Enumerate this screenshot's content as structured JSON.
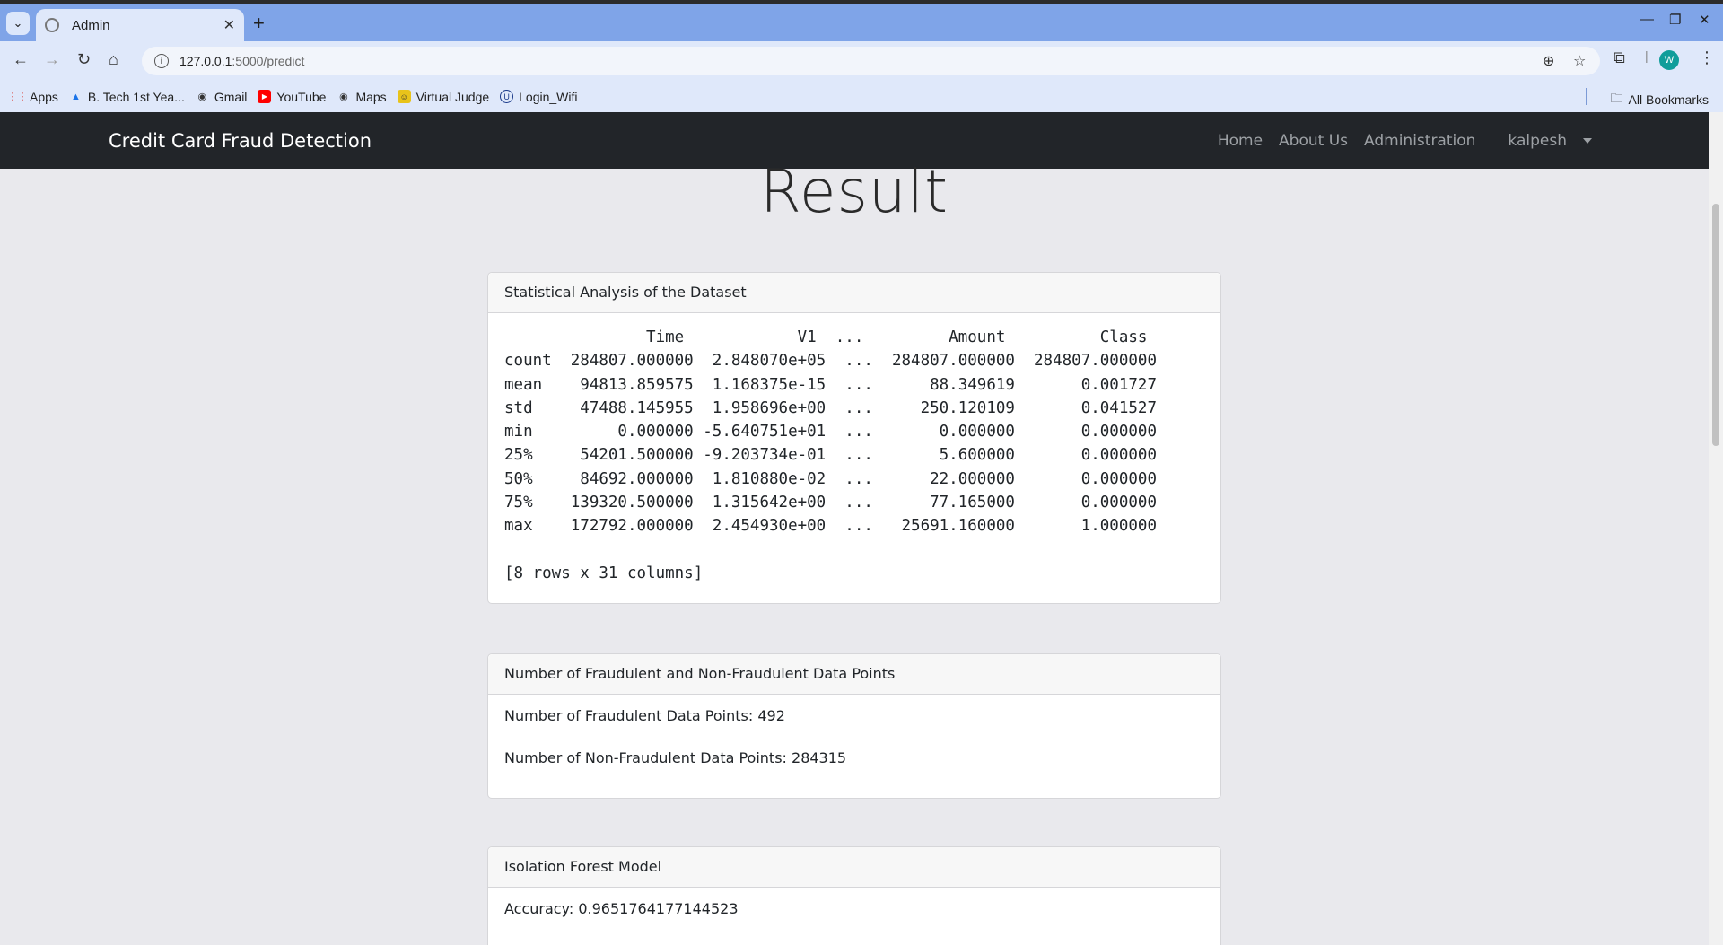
{
  "browser": {
    "tab_title": "Admin",
    "url_host": "127.0.0.1",
    "url_path": ":5000/predict",
    "avatar_letter": "W",
    "bookmarks": [
      {
        "label": "Apps",
        "icon": "apps-grid-icon"
      },
      {
        "label": "B. Tech 1st Yea...",
        "icon": "google-drive-icon"
      },
      {
        "label": "Gmail",
        "icon": "globe-icon"
      },
      {
        "label": "YouTube",
        "icon": "youtube-icon"
      },
      {
        "label": "Maps",
        "icon": "globe-icon"
      },
      {
        "label": "Virtual Judge",
        "icon": "virtual-judge-icon"
      },
      {
        "label": "Login_Wifi",
        "icon": "login-wifi-icon"
      }
    ],
    "all_bookmarks": "All Bookmarks"
  },
  "navbar": {
    "brand": "Credit Card Fraud Detection",
    "links": [
      "Home",
      "About Us",
      "Administration",
      "kalpesh"
    ]
  },
  "page": {
    "title": "Result"
  },
  "cards": {
    "stats": {
      "header": "Statistical Analysis of the Dataset",
      "table": "               Time            V1  ...         Amount          Class\ncount  284807.000000  2.848070e+05  ...  284807.000000  284807.000000\nmean    94813.859575  1.168375e-15  ...      88.349619       0.001727\nstd     47488.145955  1.958696e+00  ...     250.120109       0.041527\nmin         0.000000 -5.640751e+01  ...       0.000000       0.000000\n25%     54201.500000 -9.203734e-01  ...       5.600000       0.000000\n50%     84692.000000  1.810880e-02  ...      22.000000       0.000000\n75%    139320.500000  1.315642e+00  ...      77.165000       0.000000\nmax    172792.000000  2.454930e+00  ...   25691.160000       1.000000\n\n[8 rows x 31 columns]"
    },
    "counts": {
      "header": "Number of Fraudulent and Non-Fraudulent Data Points",
      "fraud": "Number of Fraudulent Data Points: 492",
      "nonfraud": "Number of Non-Fraudulent Data Points: 284315"
    },
    "isolation": {
      "header": "Isolation Forest Model",
      "accuracy": "Accuracy: 0.9651764177144523"
    }
  }
}
